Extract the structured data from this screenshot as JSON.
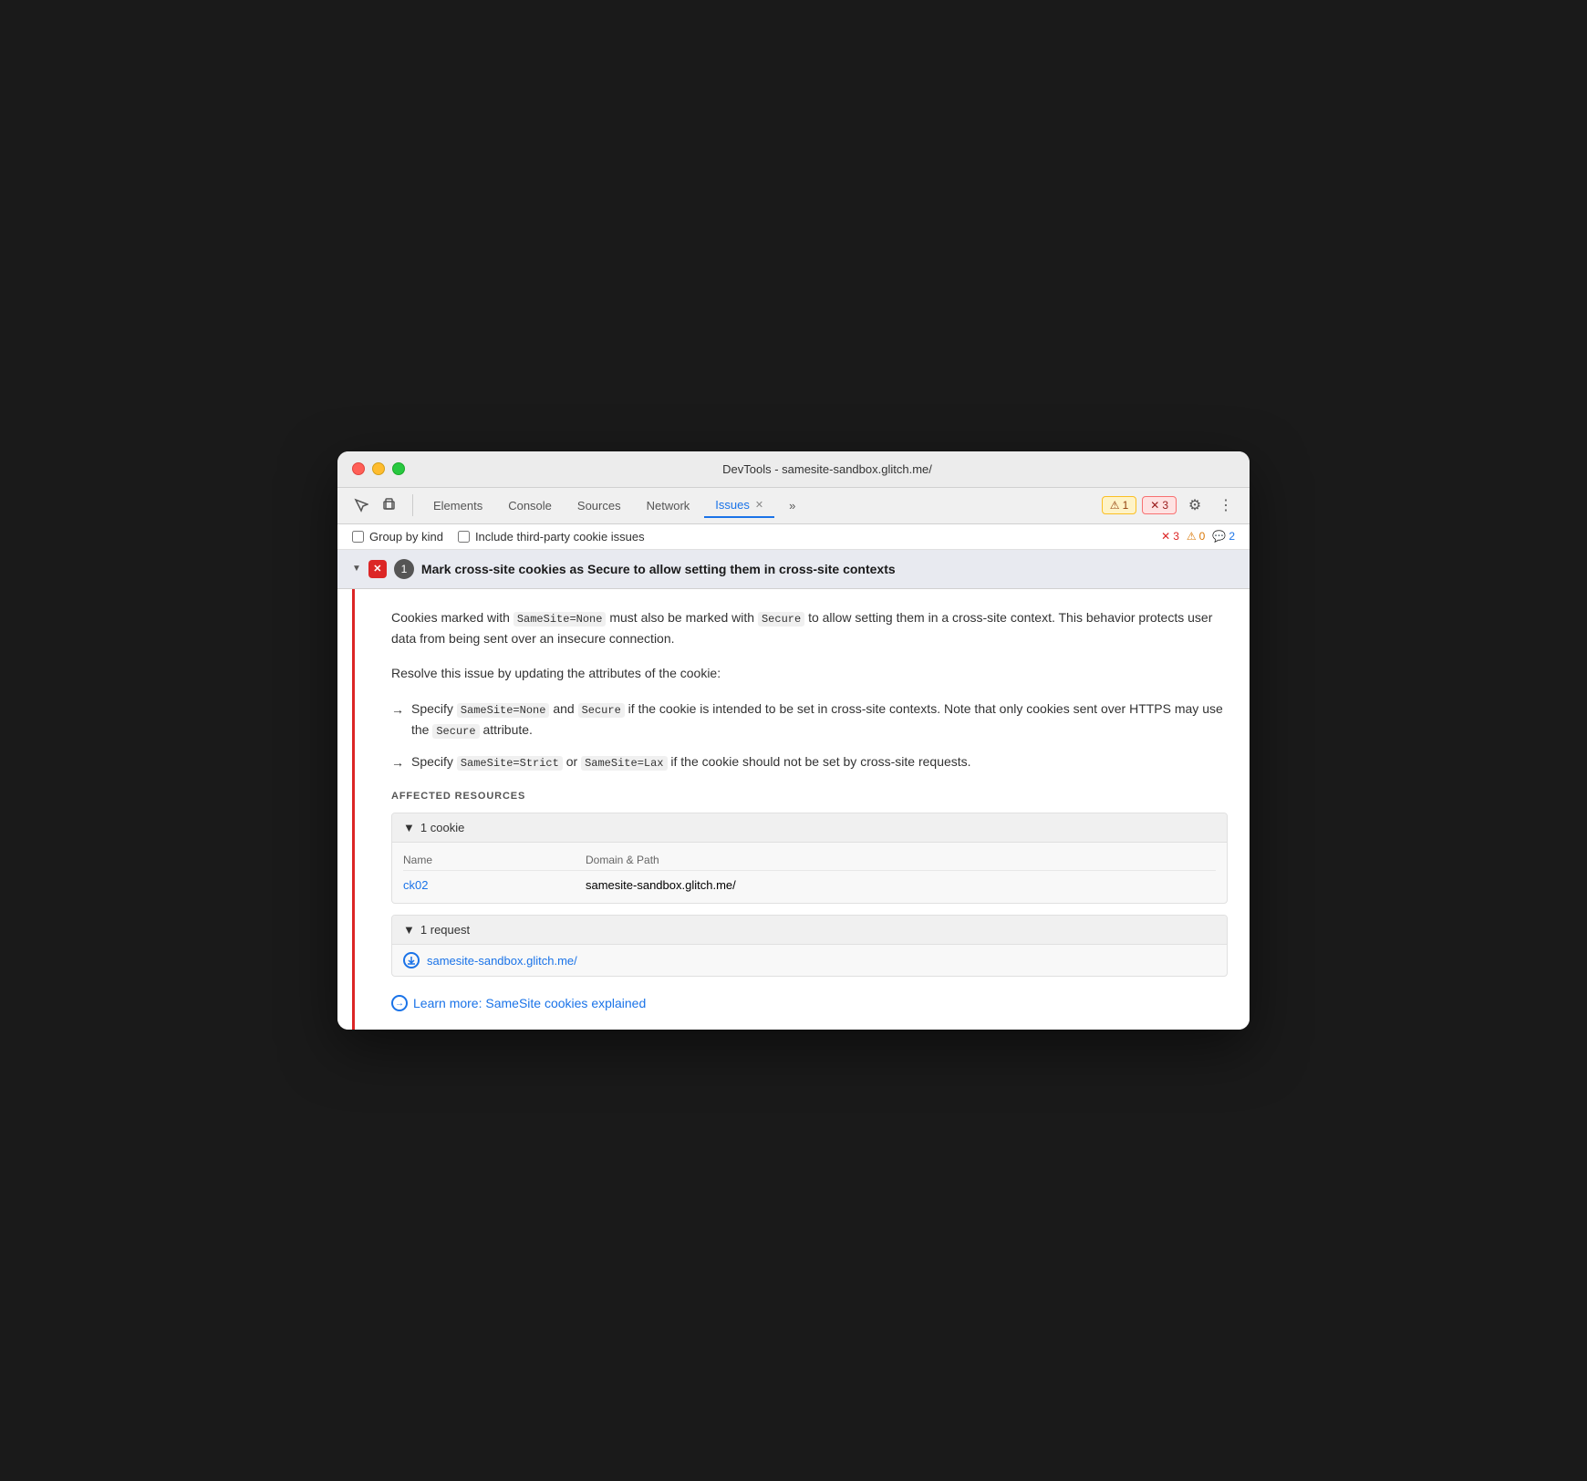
{
  "window": {
    "title": "DevTools - samesite-sandbox.glitch.me/"
  },
  "toolbar": {
    "inspect_label": "Inspect",
    "device_label": "Device",
    "tabs": [
      {
        "id": "elements",
        "label": "Elements",
        "active": false
      },
      {
        "id": "console",
        "label": "Console",
        "active": false
      },
      {
        "id": "sources",
        "label": "Sources",
        "active": false
      },
      {
        "id": "network",
        "label": "Network",
        "active": false
      },
      {
        "id": "issues",
        "label": "Issues",
        "active": true
      }
    ],
    "more_tabs": "»",
    "badge_warning": {
      "icon": "⚠",
      "count": "1"
    },
    "badge_error": {
      "icon": "✕",
      "count": "3"
    },
    "gear_icon": "⚙",
    "more_icon": "⋮"
  },
  "filter_bar": {
    "group_by_kind_label": "Group by kind",
    "third_party_label": "Include third-party cookie issues",
    "counts": {
      "error": {
        "icon": "✕",
        "value": "3"
      },
      "warning": {
        "icon": "⚠",
        "value": "0"
      },
      "info": {
        "icon": "💬",
        "value": "2"
      }
    }
  },
  "issue": {
    "count": "1",
    "title": "Mark cross-site cookies as Secure to allow setting them in cross-site contexts",
    "description": "Cookies marked with SameSite=None must also be marked with Secure to allow setting them in a cross-site context. This behavior protects user data from being sent over an insecure connection.",
    "resolve_intro": "Resolve this issue by updating the attributes of the cookie:",
    "bullets": [
      {
        "arrow": "→",
        "text_before": "Specify",
        "code1": "SameSite=None",
        "text_middle": "and",
        "code2": "Secure",
        "text_after": "if the cookie is intended to be set in cross-site contexts. Note that only cookies sent over HTTPS may use the",
        "code3": "Secure",
        "text_end": "attribute."
      },
      {
        "arrow": "→",
        "text_before": "Specify",
        "code1": "SameSite=Strict",
        "text_middle": "or",
        "code2": "SameSite=Lax",
        "text_after": "if the cookie should not be set by cross-site requests."
      }
    ],
    "affected_resources": {
      "label": "AFFECTED RESOURCES",
      "cookie_section": {
        "count": "1",
        "label": "cookie",
        "columns": [
          "Name",
          "Domain & Path"
        ],
        "rows": [
          {
            "name": "ck02",
            "domain": "samesite-sandbox.glitch.me/"
          }
        ]
      },
      "request_section": {
        "count": "1",
        "label": "request",
        "url": "samesite-sandbox.glitch.me/"
      }
    },
    "learn_more": {
      "text": "Learn more: SameSite cookies explained",
      "url": "#"
    }
  }
}
